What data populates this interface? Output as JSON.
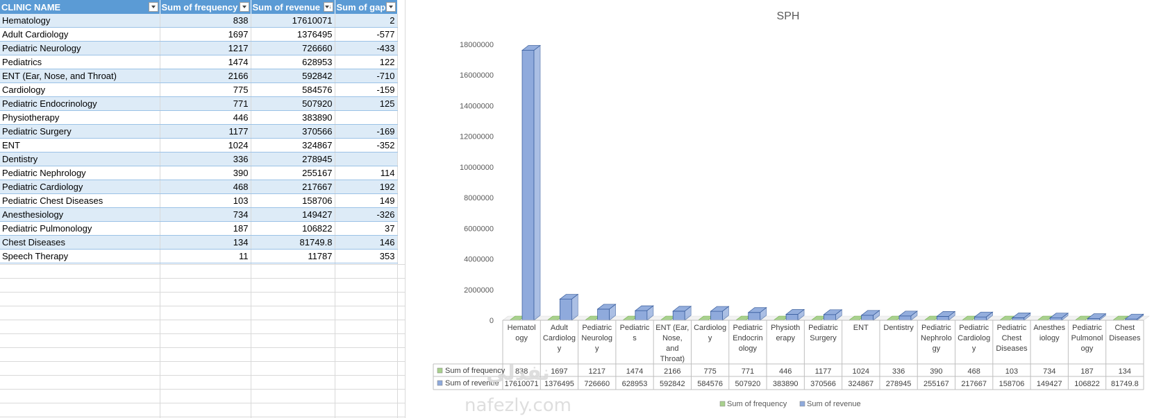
{
  "pivot": {
    "headers": [
      "CLINIC NAME",
      "Sum of frequency",
      "Sum of revenue",
      "Sum of gap"
    ],
    "rows": [
      [
        "Hematology",
        "838",
        "17610071",
        "2"
      ],
      [
        "Adult Cardiology",
        "1697",
        "1376495",
        "-577"
      ],
      [
        "Pediatric Neurology",
        "1217",
        "726660",
        "-433"
      ],
      [
        "Pediatrics",
        "1474",
        "628953",
        "122"
      ],
      [
        "ENT (Ear, Nose, and Throat)",
        "2166",
        "592842",
        "-710"
      ],
      [
        "Cardiology",
        "775",
        "584576",
        "-159"
      ],
      [
        "Pediatric Endocrinology",
        "771",
        "507920",
        "125"
      ],
      [
        "Physiotherapy",
        "446",
        "383890",
        ""
      ],
      [
        "Pediatric Surgery",
        "1177",
        "370566",
        "-169"
      ],
      [
        "ENT",
        "1024",
        "324867",
        "-352"
      ],
      [
        "Dentistry",
        "336",
        "278945",
        ""
      ],
      [
        "Pediatric Nephrology",
        "390",
        "255167",
        "114"
      ],
      [
        "Pediatric Cardiology",
        "468",
        "217667",
        "192"
      ],
      [
        "Pediatric Chest Diseases",
        "103",
        "158706",
        "149"
      ],
      [
        "Anesthesiology",
        "734",
        "149427",
        "-326"
      ],
      [
        "Pediatric Pulmonology",
        "187",
        "106822",
        "37"
      ],
      [
        "Chest Diseases",
        "134",
        "81749.8",
        "146"
      ],
      [
        "Speech Therapy",
        "11",
        "11787",
        "353"
      ]
    ]
  },
  "colors": {
    "header_bg": "#5b9bd5",
    "band_bg": "#ddebf7",
    "revenue_bar": "#8faadc",
    "frequency_bar": "#a9d18e"
  },
  "watermark": {
    "brand_ar": "نفذلي",
    "brand_en": "nafezly.com"
  },
  "chart_data": {
    "type": "bar",
    "title": "SPH",
    "categories": [
      [
        "Hematol",
        "ogy"
      ],
      [
        "Adult",
        "Cardiolog",
        "y"
      ],
      [
        "Pediatric",
        "Neurolog",
        "y"
      ],
      [
        "Pediatric",
        "s"
      ],
      [
        "ENT (Ear,",
        "Nose,",
        "and",
        "Throat)"
      ],
      [
        "Cardiolog",
        "y"
      ],
      [
        "Pediatric",
        "Endocrin",
        "ology"
      ],
      [
        "Physioth",
        "erapy"
      ],
      [
        "Pediatric",
        "Surgery"
      ],
      [
        "ENT"
      ],
      [
        "Dentistry"
      ],
      [
        "Pediatric",
        "Nephrolo",
        "gy"
      ],
      [
        "Pediatric",
        "Cardiolog",
        "y"
      ],
      [
        "Pediatric",
        "Chest",
        "Diseases"
      ],
      [
        "Anesthes",
        "iology"
      ],
      [
        "Pediatric",
        "Pulmonol",
        "ogy"
      ],
      [
        "Chest",
        "Diseases"
      ]
    ],
    "series": [
      {
        "name": "Sum of frequency",
        "color": "#a9d18e",
        "values": [
          838,
          1697,
          1217,
          1474,
          2166,
          775,
          771,
          446,
          1177,
          1024,
          336,
          390,
          468,
          103,
          734,
          187,
          134
        ],
        "labels": [
          "838",
          "1697",
          "1217",
          "1474",
          "2166",
          "775",
          "771",
          "446",
          "1177",
          "1024",
          "336",
          "390",
          "468",
          "103",
          "734",
          "187",
          "134"
        ]
      },
      {
        "name": "Sum of revenue",
        "color": "#8faadc",
        "values": [
          17610071,
          1376495,
          726660,
          628953,
          592842,
          584576,
          507920,
          383890,
          370566,
          324867,
          278945,
          255167,
          217667,
          158706,
          149427,
          106822,
          81749.8
        ],
        "labels": [
          "17610071",
          "1376495",
          "726660",
          "628953",
          "592842",
          "584576",
          "507920",
          "383890",
          "370566",
          "324867",
          "278945",
          "255167",
          "217667",
          "158706",
          "149427",
          "106822",
          "81749.8"
        ]
      }
    ],
    "ylim": [
      0,
      18000000
    ],
    "yticks": [
      "0",
      "2000000",
      "4000000",
      "6000000",
      "8000000",
      "10000000",
      "12000000",
      "14000000",
      "16000000",
      "18000000"
    ],
    "grid": false,
    "legend": "bottom",
    "data_table": true,
    "style": "3d-column"
  }
}
